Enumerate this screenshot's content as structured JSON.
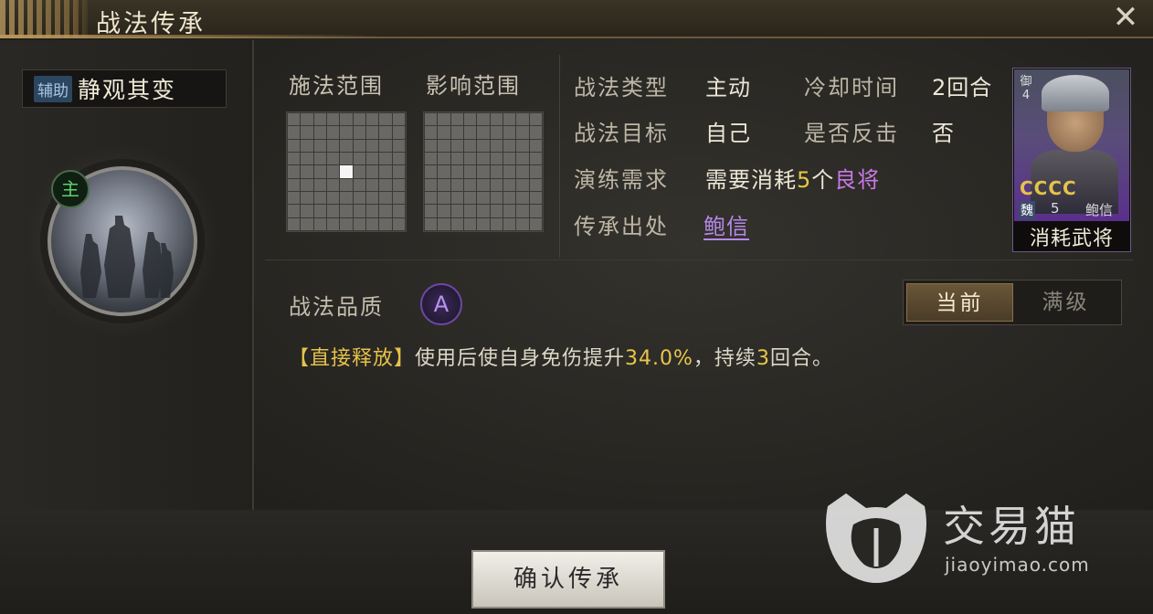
{
  "window": {
    "title": "战法传承",
    "close_symbol": "✕"
  },
  "skill": {
    "category_tag": "辅助",
    "name": "静观其变",
    "main_badge": "主"
  },
  "ranges": {
    "cast_label": "施法范围",
    "effect_label": "影响范围"
  },
  "info": {
    "type_label": "战法类型",
    "type_value": "主动",
    "cooldown_label": "冷却时间",
    "cooldown_value": "2回合",
    "target_label": "战法目标",
    "target_value": "自己",
    "counter_label": "是否反击",
    "counter_value": "否",
    "require_label": "演练需求",
    "require_prefix": "需要消耗",
    "require_count": "5",
    "require_unit": "个",
    "require_item": "良将",
    "source_label": "传承出处",
    "source_value": "鲍信"
  },
  "card": {
    "rank": "御",
    "rank_num": "4",
    "stars": "CCCC",
    "faction": "魏",
    "cost": "5",
    "name": "鲍信",
    "caption": "消耗武将"
  },
  "quality": {
    "label": "战法品质",
    "grade": "A"
  },
  "toggle": {
    "current": "当前",
    "max": "满级"
  },
  "description": {
    "tag": "【直接释放】",
    "text1": "使用后使自身免伤提升",
    "value1": "34.0%",
    "text2": "，持续",
    "value2": "3",
    "text3": "回合。"
  },
  "confirm_label": "确认传承",
  "watermark": {
    "name": "交易猫",
    "url": "jiaoyimao.com"
  },
  "colors": {
    "accent_gold": "#e8c64a",
    "accent_purple": "#c978e6",
    "main_green": "#5fd06b"
  }
}
